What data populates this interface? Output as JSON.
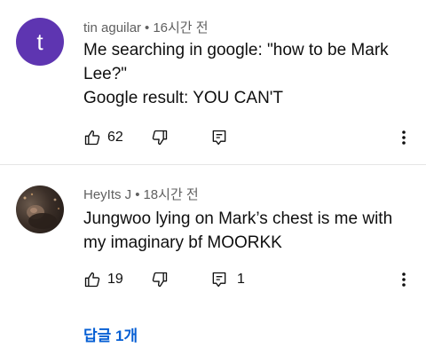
{
  "comments": [
    {
      "avatar_letter": "t",
      "avatar_color": "#5e35b1",
      "author": "tin aguilar",
      "separator": "•",
      "time": "16시간 전",
      "lines": [
        "Me searching in google: \"how to be Mark",
        "Lee?\"",
        "Google result: YOU CAN'T"
      ],
      "like_count": "62",
      "reply_count": ""
    },
    {
      "avatar_letter": "",
      "author": "HeyIts J",
      "separator": "•",
      "time": "18시간 전",
      "lines": [
        "Jungwoo lying on Mark’s chest is me with",
        "my imaginary bf MOORKK"
      ],
      "like_count": "19",
      "reply_count": "1"
    }
  ],
  "replies_link": "답글 1개",
  "icons": {
    "like": "thumbs-up-icon",
    "dislike": "thumbs-down-icon",
    "reply": "reply-icon",
    "more": "more-vertical-icon"
  },
  "colors": {
    "link": "#065fd4",
    "meta": "#606060",
    "text": "#0f0f0f"
  }
}
